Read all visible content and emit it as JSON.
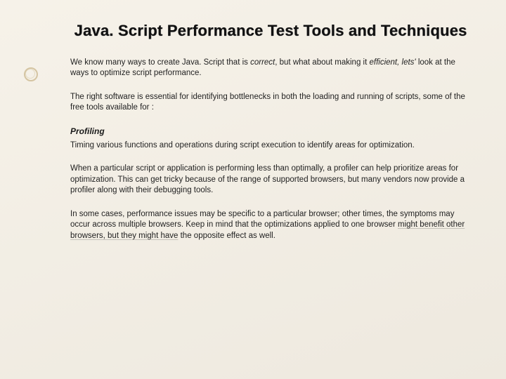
{
  "title": "Java. Script Performance Test Tools and Techniques",
  "p1_a": "We know many ways to create Java. Script that is ",
  "p1_correct": "correct",
  "p1_b": ", but what about making it ",
  "p1_eff": "efficient, lets'",
  "p1_c": " look at the ways to optimize script performance.",
  "p2": "The right software is essential for identifying bottlenecks in both the loading and running of scripts, some of the free tools available for :",
  "subhead": "Profiling",
  "p3": "Timing various functions and operations during script execution to identify areas for optimization.",
  "p4": "When a particular script or application is performing less than optimally, a profiler can help prioritize areas for optimization. This can get tricky because of the range of supported browsers, but many vendors now provide a profiler along with their debugging tools.",
  "p5_a": "In some cases, performance issues may be specific to a particular browser; other times, the symptoms may occur across multiple browsers. Keep in mind that the optimizations applied to one browser ",
  "p5_u": "might benefit other browsers, but they might have",
  "p5_b": " the opposite effect as well."
}
